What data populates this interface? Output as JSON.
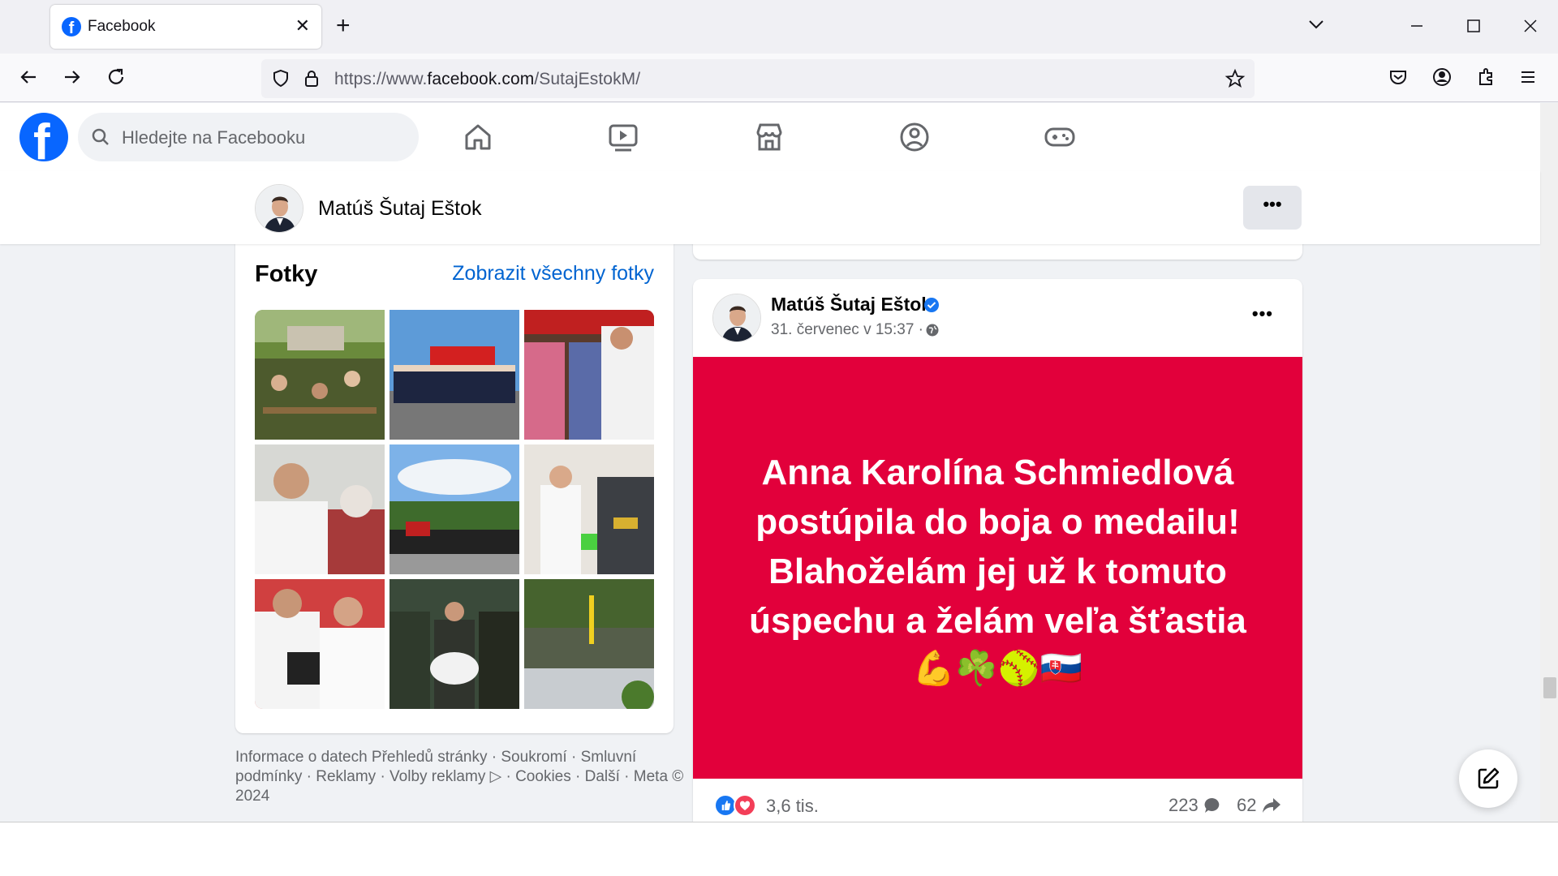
{
  "browser": {
    "tab_title": "Facebook",
    "tab_close": "✕",
    "new_tab": "+",
    "url_prefix": "https://www.",
    "url_domain": "facebook.com",
    "url_path": "/SutajEstokM/"
  },
  "fb": {
    "logo": "f",
    "search_placeholder": "Hledejte na Facebooku"
  },
  "page": {
    "name": "Matúš Šutaj Eštok",
    "more_label": "•••"
  },
  "photos": {
    "title": "Fotky",
    "link": "Zobrazit všechny fotky"
  },
  "footer": {
    "text": "Informace o datech Přehledů stránky · Soukromí · Smluvní podmínky · Reklamy · Volby reklamy ▷ · Cookies · Další · Meta © 2024"
  },
  "post": {
    "author": "Matúš Šutaj Eštok",
    "time": "31. červenec v 15:37 ·",
    "more_label": "•••",
    "image_text": "Anna Karolína Schmiedlová postúpila do boja o medailu! Blahoželám jej už k tomuto úspechu a želám veľa šťastia",
    "image_emoji": "💪☘️🥎🇸🇰",
    "reactions": "3,6 tis.",
    "comments": "223",
    "shares": "62"
  },
  "colors": {
    "brand": "#0866ff",
    "post_bg": "#e2003b",
    "link": "#0064d1"
  }
}
